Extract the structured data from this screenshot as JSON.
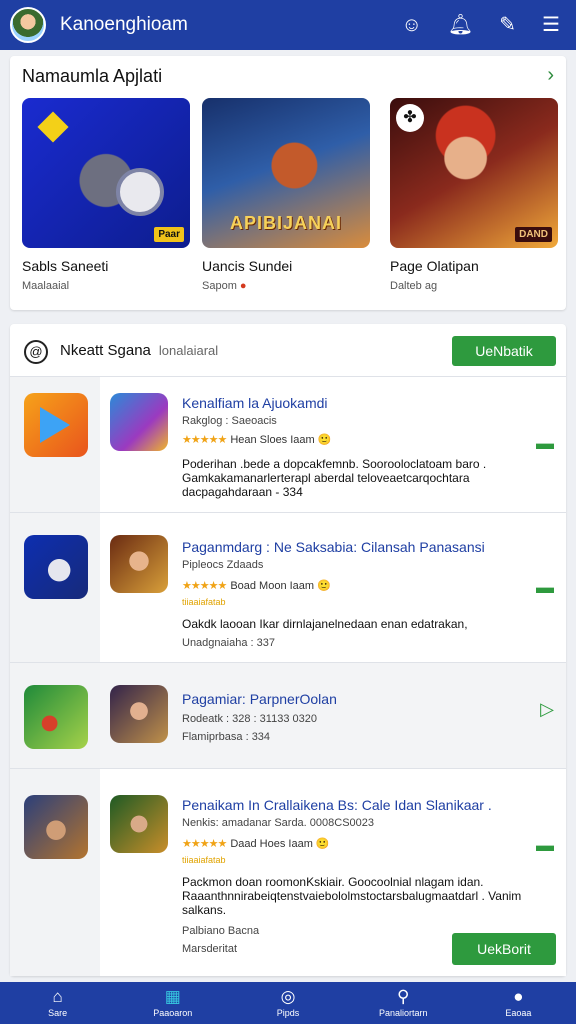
{
  "header": {
    "app_title": "Kanoenghioam",
    "icons": [
      "contacts-icon",
      "bell-icon",
      "feather-icon",
      "menu-icon"
    ]
  },
  "featured": {
    "title": "Namaumla Apjlati",
    "cards": [
      {
        "name": "Sabls Saneeti",
        "sub": "Maalaaial",
        "tag": "Paar"
      },
      {
        "name": "Uancis Sundei",
        "sub": "Sapom",
        "overlay": "APIBIJANAI"
      },
      {
        "name": "Page Olatipan",
        "sub": "Dalteb ag",
        "tag": "DAND"
      }
    ]
  },
  "list": {
    "title": "Nkeatt Sgana",
    "subtitle": "lonalaiaral",
    "header_button": "UeNbatik",
    "rows": [
      {
        "title": "Kenalfiam la Ajuokamdi",
        "sub": "Rakglog : Saeoacis",
        "rating_text": "Hean Sloes Iaam",
        "desc": "Poderihan .bede a dopcakfemnb. Soorooloclatoam baro . Gamkakamanarlerterapl aberdal teloveaetcarqochtara dacpagahdaraan - 334"
      },
      {
        "title": "Paganmdarg : Ne Saksabia: Cilansah Panasansi",
        "sub": "Pipleocs Zdaads",
        "rating_text": "Boad Moon Iaam",
        "meta": "tiiaaiafatab",
        "desc": "Oakdk laooan Ikar dirnlajanelnedaan enan edatrakan,",
        "foot": "Unadgnaiaha : 337"
      },
      {
        "title": "Pagamiar: ParpnerOolan",
        "sub": "Rodeatk : 328 : 31133 0320",
        "foot": "Flamiprbasa : 334"
      },
      {
        "title": "Penaikam In Crallaikena Bs: Cale Idan Slanikaar .",
        "sub": "Nenkis: amadanar Sarda. 0008CS0023",
        "rating_text": "Daad Hoes Iaam",
        "meta": "tiiaaiafatab",
        "desc": "Packmon doan roomonKskiair. Goocoolnial nlagam idan. Raaanthnnirabeiqtenstvaiebololmstoctarsbalugmaatdarl . Vanim salkans.",
        "foot1": "Palbiano Bacna",
        "foot2": "Marsderitat",
        "button": "UekBorit"
      }
    ]
  },
  "bottom_nav": [
    {
      "label": "Sare",
      "icon": "home-icon"
    },
    {
      "label": "Paaoaron",
      "icon": "grid-icon"
    },
    {
      "label": "Pipds",
      "icon": "target-icon"
    },
    {
      "label": "Panaliortarn",
      "icon": "profile-search-icon"
    },
    {
      "label": "Eaoaa",
      "icon": "user-icon"
    }
  ]
}
